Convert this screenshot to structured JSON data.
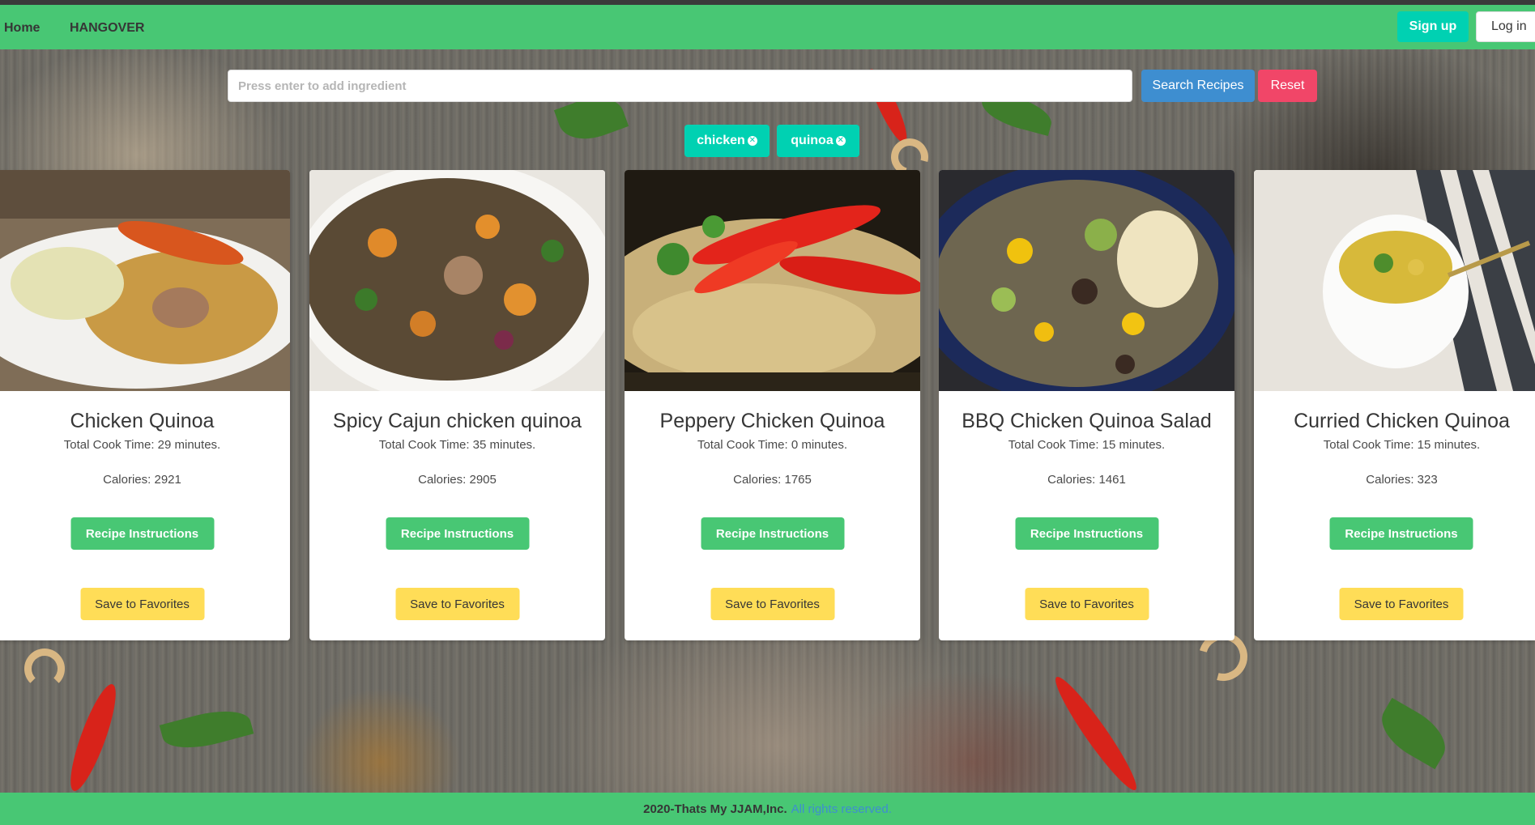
{
  "navbar": {
    "items": [
      {
        "label": "Home"
      },
      {
        "label": "HANGOVER"
      }
    ],
    "signup_label": "Sign up",
    "login_label": "Log in"
  },
  "search": {
    "placeholder": "Press enter to add ingredient",
    "value": "",
    "search_label": "Search Recipes",
    "reset_label": "Reset"
  },
  "tags": [
    {
      "label": "chicken"
    },
    {
      "label": "quinoa"
    }
  ],
  "recipes": [
    {
      "title": "Chicken Quinoa",
      "cook_time": "Total Cook Time: 29 minutes.",
      "calories": "Calories: 2921",
      "instructions_label": "Recipe Instructions",
      "favorite_label": "Save to Favorites"
    },
    {
      "title": "Spicy Cajun chicken quinoa",
      "cook_time": "Total Cook Time: 35 minutes.",
      "calories": "Calories: 2905",
      "instructions_label": "Recipe Instructions",
      "favorite_label": "Save to Favorites"
    },
    {
      "title": "Peppery Chicken Quinoa",
      "cook_time": "Total Cook Time: 0 minutes.",
      "calories": "Calories: 1765",
      "instructions_label": "Recipe Instructions",
      "favorite_label": "Save to Favorites"
    },
    {
      "title": "BBQ Chicken Quinoa Salad",
      "cook_time": "Total Cook Time: 15 minutes.",
      "calories": "Calories: 1461",
      "instructions_label": "Recipe Instructions",
      "favorite_label": "Save to Favorites"
    },
    {
      "title": "Curried Chicken Quinoa",
      "cook_time": "Total Cook Time: 15 minutes.",
      "calories": "Calories: 323",
      "instructions_label": "Recipe Instructions",
      "favorite_label": "Save to Favorites"
    }
  ],
  "footer": {
    "text": "2020-Thats My JJAM,Inc.",
    "link": "All rights reserved."
  },
  "colors": {
    "primary": "#48c774",
    "accent_teal": "#00d1b2",
    "info_blue": "#3e8ed0",
    "danger": "#f14668",
    "warning": "#ffdd57"
  }
}
